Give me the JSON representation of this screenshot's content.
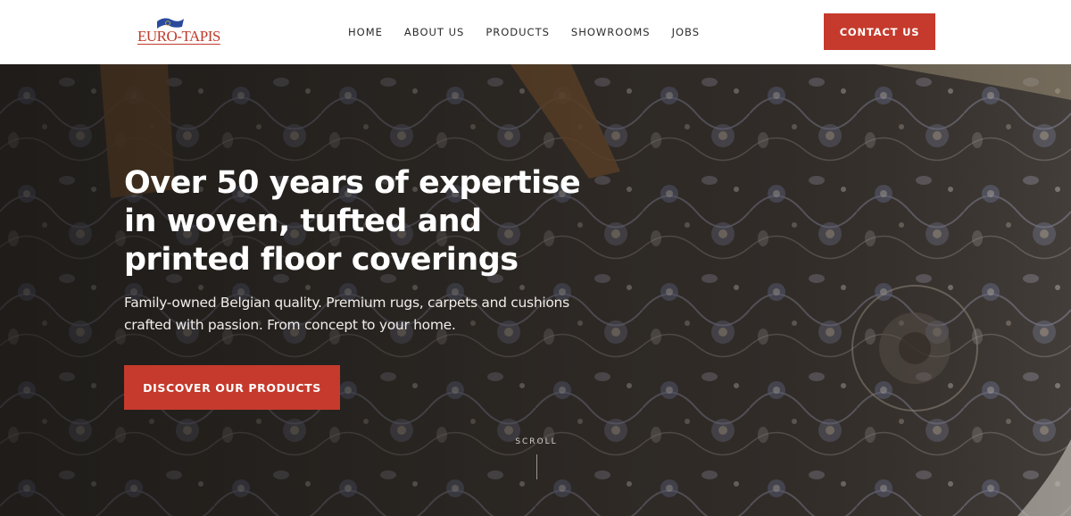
{
  "brand": {
    "logo_text": "EURO-TAPIS",
    "accent_color": "#c53a2c",
    "logo_flag_color": "#2b4a9c"
  },
  "nav": {
    "items": [
      "HOME",
      "ABOUT US",
      "PRODUCTS",
      "SHOWROOMS",
      "JOBS"
    ],
    "contact_label": "CONTACT US"
  },
  "hero": {
    "title": "Over 50 years of expertise in woven, tufted and printed floor coverings",
    "subtitle": "Family-owned Belgian quality. Premium rugs, carpets and cushions crafted with passion. From concept to your home.",
    "cta_label": "DISCOVER OUR PRODUCTS",
    "scroll_label": "SCROLL"
  }
}
